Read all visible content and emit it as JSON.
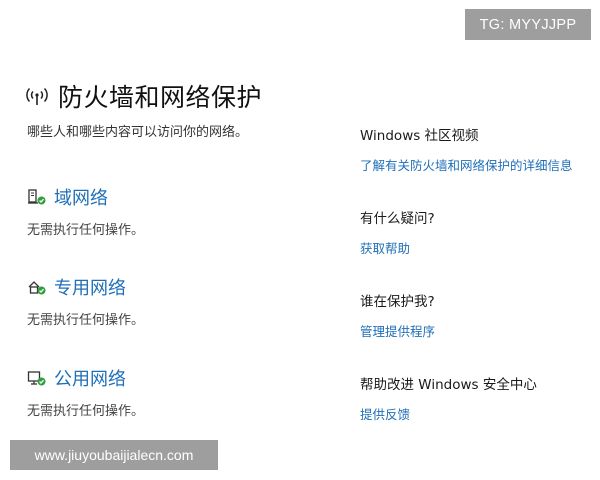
{
  "watermarks": {
    "top": "TG: MYYJJPP",
    "bottom": "www.jiuyoubaijialecn.com"
  },
  "header": {
    "icon": "firewall-antenna-icon",
    "title": "防火墙和网络保护",
    "subtitle": "哪些人和哪些内容可以访问你的网络。"
  },
  "networks": [
    {
      "icon": "domain-network-icon",
      "name": "域网络",
      "status": "无需执行任何操作。"
    },
    {
      "icon": "private-network-icon",
      "name": "专用网络",
      "status": "无需执行任何操作。"
    },
    {
      "icon": "public-network-icon",
      "name": "公用网络",
      "status": "无需执行任何操作。"
    }
  ],
  "sidebar": [
    {
      "heading": "Windows 社区视频",
      "link": "了解有关防火墙和网络保护的详细信息"
    },
    {
      "heading": "有什么疑问?",
      "link": "获取帮助"
    },
    {
      "heading": "谁在保护我?",
      "link": "管理提供程序"
    },
    {
      "heading": "帮助改进 Windows 安全中心",
      "link": "提供反馈"
    }
  ],
  "colors": {
    "link": "#1f6fb8",
    "check": "#2e9e3e"
  }
}
